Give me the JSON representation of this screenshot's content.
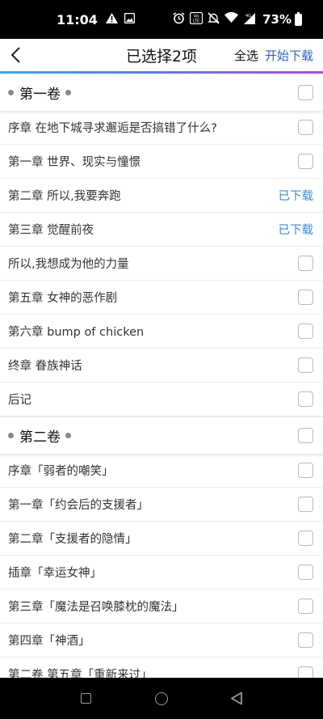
{
  "status_bar": {
    "time": "11:04",
    "battery": "73%",
    "icons": [
      "alert-icon",
      "image-icon",
      "alarm-icon",
      "volte-icon",
      "mute-icon",
      "wifi-icon",
      "signal-icon",
      "battery-icon"
    ],
    "volte_text": "Vo LTE",
    "signal_text": "4G"
  },
  "header": {
    "back_icon": "chevron-left-icon",
    "title": "已选择2项",
    "select_all": "全选",
    "start_download": "开始下载",
    "accent_gradient": [
      "#3aa8e8",
      "#5a7ee8",
      "#b04cd0"
    ]
  },
  "volumes": [
    {
      "title": "第一卷",
      "chapters": [
        {
          "title": "序章 在地下城寻求邂逅是否搞错了什么?",
          "status": "checkbox"
        },
        {
          "title": "第一章 世界、现实与憧憬",
          "status": "checkbox"
        },
        {
          "title": "第二章 所以,我要奔跑",
          "status": "downloaded",
          "status_label": "已下载"
        },
        {
          "title": "第三章 觉醒前夜",
          "status": "downloaded",
          "status_label": "已下载"
        },
        {
          "title": "所以,我想成为他的力量",
          "status": "checkbox"
        },
        {
          "title": "第五章 女神的恶作剧",
          "status": "checkbox"
        },
        {
          "title": "第六章 bump of chicken",
          "status": "checkbox"
        },
        {
          "title": "终章 眷族神话",
          "status": "checkbox"
        },
        {
          "title": "后记",
          "status": "checkbox"
        }
      ]
    },
    {
      "title": "第二卷",
      "chapters": [
        {
          "title": "序章「弱者的嘲笑」",
          "status": "checkbox"
        },
        {
          "title": "第一章「约会后的支援者」",
          "status": "checkbox"
        },
        {
          "title": "第二章「支援者的隐情」",
          "status": "checkbox"
        },
        {
          "title": "插章「幸运女神」",
          "status": "checkbox"
        },
        {
          "title": "第三章「魔法是召唤膝枕的魔法」",
          "status": "checkbox"
        },
        {
          "title": "第四章「神酒」",
          "status": "checkbox"
        },
        {
          "title": "第二卷 第五章「重新来过」",
          "status": "checkbox"
        }
      ]
    }
  ],
  "downloaded_color": "#3a8ad8",
  "nav_bar": {
    "icons": [
      "recents-square-icon",
      "home-circle-icon",
      "back-triangle-icon"
    ]
  }
}
